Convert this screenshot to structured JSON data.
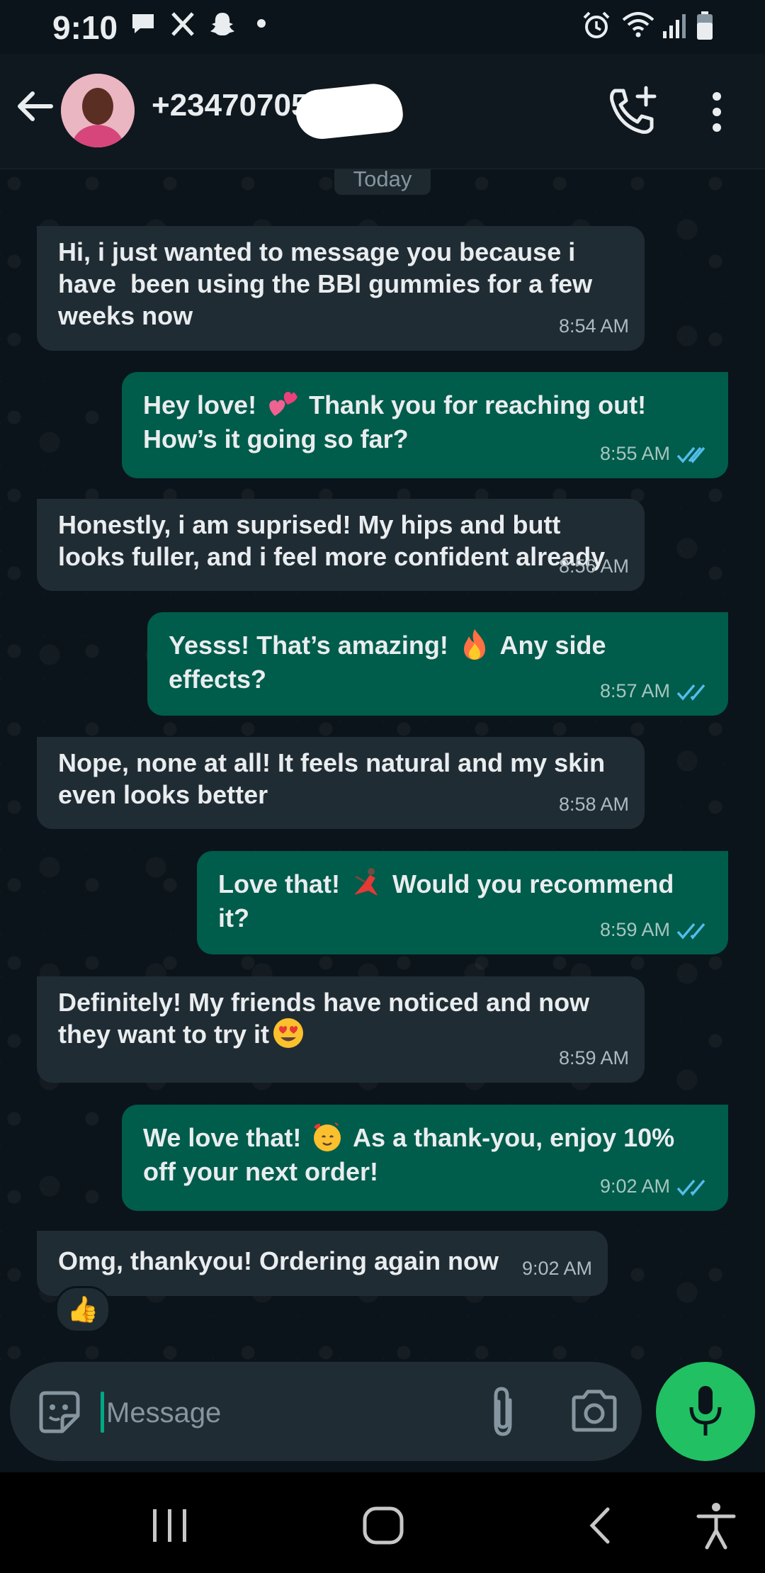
{
  "status_bar": {
    "time": "9:10",
    "left_icons": [
      "message-icon",
      "x-icon",
      "snapchat-icon",
      "dot-icon"
    ],
    "right_icons": [
      "alarm-icon",
      "wifi-icon",
      "signal-icon",
      "battery-icon"
    ]
  },
  "header": {
    "contact": "+234707052",
    "back_icon": "back-arrow-icon",
    "call_icon": "add-call-icon",
    "menu_icon": "more-vert-icon"
  },
  "chat": {
    "date_label": "Today",
    "messages": [
      {
        "dir": "in",
        "text": "Hi, i just wanted to message you because i have  been using the BBl gummies for a few weeks now",
        "time": "8:54 AM"
      },
      {
        "dir": "out",
        "text_before": "Hey love! ",
        "emoji": "two-hearts-emoji",
        "text_after": " Thank you for reaching out! How’s it going so far?",
        "time": "8:55 AM",
        "status": "read"
      },
      {
        "dir": "in",
        "text": "Honestly, i am suprised! My hips and butt looks fuller, and i feel more confident already",
        "time": "8:56 AM"
      },
      {
        "dir": "out",
        "text_before": "Yesss! That’s amazing! ",
        "emoji": "fire-emoji",
        "text_after": " Any side effects?",
        "time": "8:57 AM",
        "status": "read"
      },
      {
        "dir": "in",
        "text": "Nope, none at all! It feels natural and my skin even looks better",
        "time": "8:58 AM"
      },
      {
        "dir": "out",
        "text_before": "Love that! ",
        "emoji": "dancer-emoji",
        "text_after": " Would you recommend it?",
        "time": "8:59 AM",
        "status": "read"
      },
      {
        "dir": "in",
        "text_before": "Definitely! My friends have noticed and now they want to try it",
        "emoji": "heart-eyes-emoji",
        "time": "8:59 AM"
      },
      {
        "dir": "out",
        "text_before": "We love that! ",
        "emoji": "smiling-hearts-emoji",
        "text_after": " As a thank-you, enjoy 10% off your next order!",
        "time": "9:02 AM",
        "status": "read"
      },
      {
        "dir": "in",
        "text": "Omg, thankyou! Ordering again now",
        "time": "9:02 AM",
        "reaction": "👍"
      }
    ]
  },
  "composer": {
    "placeholder": "Message",
    "sticker_icon": "sticker-icon",
    "attach_icon": "paperclip-icon",
    "camera_icon": "camera-icon",
    "mic_icon": "mic-icon"
  },
  "nav_bar": {
    "icons": [
      "recent-apps-icon",
      "home-icon",
      "back-icon",
      "accessibility-icon"
    ]
  },
  "colors": {
    "background": "#0b141a",
    "incoming_bubble": "#202c33",
    "outgoing_bubble": "#005c4b",
    "accent": "#21c063",
    "read_ticks": "#53bdeb"
  }
}
